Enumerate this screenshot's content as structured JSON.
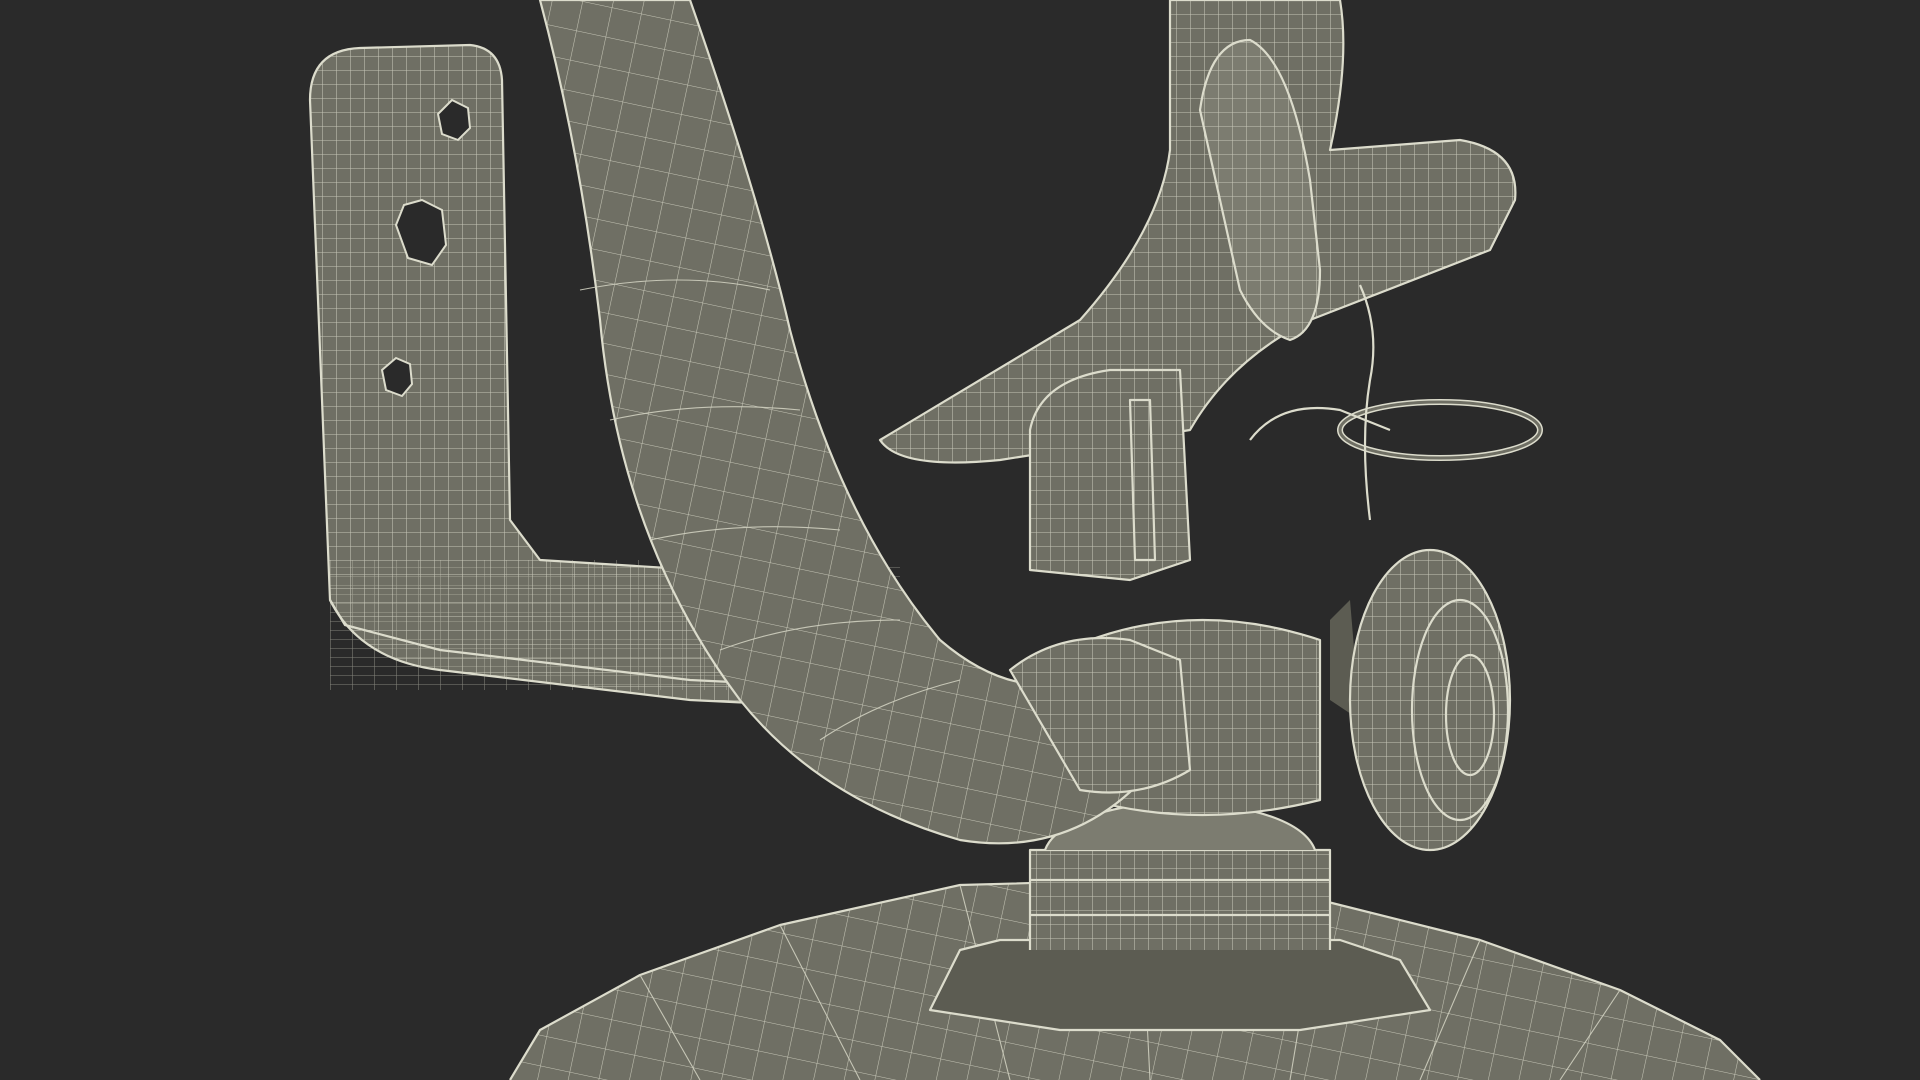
{
  "scene": {
    "background_color": "#2a2a2a",
    "mesh_color": "#6f6f64",
    "wire_color": "#dcdccc",
    "subject": "wireframe-valve-assembly"
  }
}
